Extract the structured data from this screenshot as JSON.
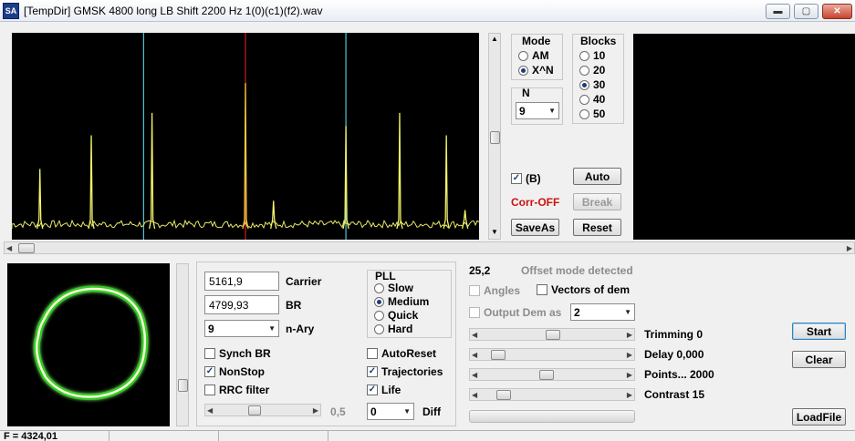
{
  "window": {
    "title": "[TempDir] GMSK 4800 long LB Shift 2200 Hz 1(0)(c1)(f2).wav",
    "app_icon_text": "SA",
    "minimize_glyph": "▬",
    "maximize_glyph": "▢",
    "close_glyph": "✕"
  },
  "spectrum": {
    "peaks": [
      {
        "x": 0.06,
        "h": 0.32,
        "color": "#f2f26a"
      },
      {
        "x": 0.17,
        "h": 0.5,
        "color": "#f2f26a"
      },
      {
        "x": 0.3,
        "h": 0.62,
        "color": "#f2f26a"
      },
      {
        "x": 0.5,
        "h": 0.78,
        "color": "#f2c840"
      },
      {
        "x": 0.56,
        "h": 0.15,
        "color": "#f2f26a"
      },
      {
        "x": 0.715,
        "h": 0.55,
        "color": "#f2f26a"
      },
      {
        "x": 0.83,
        "h": 0.62,
        "color": "#f2f26a"
      },
      {
        "x": 0.93,
        "h": 0.5,
        "color": "#f2f26a"
      },
      {
        "x": 0.97,
        "h": 0.1,
        "color": "#f2f26a"
      }
    ],
    "markers": [
      {
        "x": 0.282,
        "color": "#4fc3d6"
      },
      {
        "x": 0.5,
        "color": "#c81e1e"
      },
      {
        "x": 0.715,
        "color": "#4fc3d6"
      }
    ]
  },
  "mode": {
    "title": "Mode",
    "options": [
      {
        "label": "AM",
        "selected": false
      },
      {
        "label": "X^N",
        "selected": true
      }
    ]
  },
  "n_group": {
    "title": "N",
    "value": "9"
  },
  "blocks": {
    "title": "Blocks",
    "options": [
      {
        "label": "10",
        "selected": false
      },
      {
        "label": "20",
        "selected": false
      },
      {
        "label": "30",
        "selected": true
      },
      {
        "label": "40",
        "selected": false
      },
      {
        "label": "50",
        "selected": false
      }
    ]
  },
  "spectrum_controls": {
    "b_checkbox": {
      "label": "(B)",
      "checked": true
    },
    "auto_label": "Auto",
    "corr_status": "Corr-OFF",
    "break_label": "Break",
    "saveas_label": "SaveAs",
    "reset_label": "Reset"
  },
  "demod": {
    "carrier_value": "5161,9",
    "carrier_label": "Carrier",
    "br_value": "4799,93",
    "br_label": "BR",
    "nary_value": "9",
    "nary_label": "n-Ary",
    "synch_br": {
      "label": "Synch BR",
      "checked": false
    },
    "nonstop": {
      "label": "NonStop",
      "checked": true
    },
    "rrc_filter": {
      "label": "RRC filter",
      "checked": false
    },
    "slider_value": "0,5",
    "slider_position": 0.4,
    "pll": {
      "title": "PLL",
      "options": [
        {
          "label": "Slow",
          "selected": false
        },
        {
          "label": "Medium",
          "selected": true
        },
        {
          "label": "Quick",
          "selected": false
        },
        {
          "label": "Hard",
          "selected": false
        }
      ]
    },
    "autoreset": {
      "label": "AutoReset",
      "checked": false
    },
    "trajectories": {
      "label": "Trajectories",
      "checked": true
    },
    "life": {
      "label": "Life",
      "checked": true
    },
    "diff_value": "0",
    "diff_label": "Diff"
  },
  "analysis": {
    "offset_value": "25,2",
    "offset_status": "Offset mode detected",
    "angles": {
      "label": "Angles",
      "checked": false
    },
    "vectors": {
      "label": "Vectors of dem",
      "checked": false
    },
    "output_dem": {
      "label": "Output Dem as",
      "checked": false
    },
    "output_value": "2",
    "sliders": [
      {
        "label": "Trimming 0",
        "position": 0.5
      },
      {
        "label": "Delay  0,000",
        "position": 0.08
      },
      {
        "label": "Points... 2000",
        "position": 0.45
      },
      {
        "label": "Contrast 15",
        "position": 0.12
      }
    ],
    "start_label": "Start",
    "clear_label": "Clear",
    "loadfile_label": "LoadFile"
  },
  "status": {
    "freq": "F = 4324,01"
  }
}
